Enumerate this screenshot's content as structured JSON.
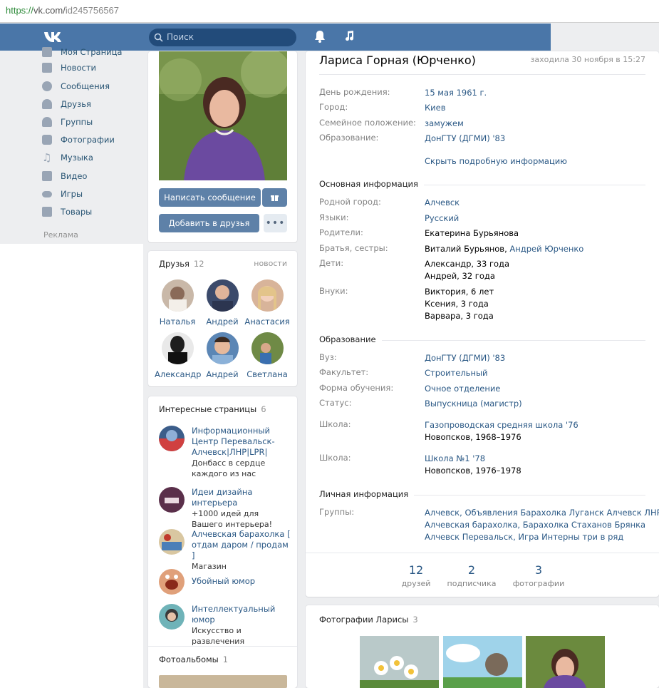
{
  "browser": {
    "proto": "https://",
    "host": "vk.com/",
    "path": "id245756567"
  },
  "header": {
    "search_placeholder": "Поиск"
  },
  "nav": {
    "items": [
      {
        "label": "Моя Страница",
        "icon": "home-icon"
      },
      {
        "label": "Новости",
        "icon": "news-icon"
      },
      {
        "label": "Сообщения",
        "icon": "messages-icon"
      },
      {
        "label": "Друзья",
        "icon": "friends-icon"
      },
      {
        "label": "Группы",
        "icon": "groups-icon"
      },
      {
        "label": "Фотографии",
        "icon": "camera-icon"
      },
      {
        "label": "Музыка",
        "icon": "music-icon"
      },
      {
        "label": "Видео",
        "icon": "video-icon"
      },
      {
        "label": "Игры",
        "icon": "gamepad-icon"
      },
      {
        "label": "Товары",
        "icon": "bag-icon"
      }
    ],
    "ads": "Реклама"
  },
  "profile_actions": {
    "message": "Написать сообщение",
    "add_friend": "Добавить в друзья"
  },
  "friends": {
    "title": "Друзья",
    "count": "12",
    "news": "новости",
    "list": [
      {
        "name": "Наталья",
        "color": "#c9b8a8"
      },
      {
        "name": "Андрей",
        "color": "#3b4a6b"
      },
      {
        "name": "Анастасия",
        "color": "#d8b49a"
      },
      {
        "name": "Александр",
        "color": "#2b2b2b"
      },
      {
        "name": "Андрей",
        "color": "#5b86b5"
      },
      {
        "name": "Светлана",
        "color": "#6f8a46"
      }
    ]
  },
  "pages": {
    "title": "Интересные страницы",
    "count": "6",
    "list": [
      {
        "name": "Информационный Центр Перевальск-Алчевск|ЛНР|LPR|",
        "desc": "Донбасс в сердце каждого из нас",
        "color": "#3b5d8a"
      },
      {
        "name": "Идеи дизайна интерьера",
        "desc": "+1000 идей для Вашего интерьера!",
        "color": "#5a2f4a"
      },
      {
        "name": "Алчевская барахолка [ отдам даром / продам ]",
        "desc": "Магазин",
        "color": "#d9c7a1"
      },
      {
        "name": "Убойный юмор",
        "desc": "",
        "color": "#e0a07a"
      },
      {
        "name": "Интеллектуальный юмор",
        "desc": "Искусство и развлечения",
        "color": "#6fb3b8"
      }
    ]
  },
  "albums": {
    "title": "Фотоальбомы",
    "count": "1"
  },
  "profile": {
    "name": "Лариса Горная (Юрченко)",
    "last_seen": "заходила 30 ноября в 15:27",
    "birthday_label": "День рождения:",
    "birthday": "15 мая 1961 г.",
    "city_label": "Город:",
    "city": "Киев",
    "family_label": "Семейное положение:",
    "family": "замужем",
    "edu_label": "Образование:",
    "edu": "ДонГТУ (ДГМИ) '83",
    "hide_info": "Скрыть подробную информацию",
    "main_info": "Основная информация",
    "hometown_label": "Родной город:",
    "hometown": "Алчевск",
    "langs_label": "Языки:",
    "langs": "Русский",
    "parents_label": "Родители:",
    "parents": "Екатерина Бурьянова",
    "siblings_label": "Братья, сестры:",
    "sibling1": "Виталий Бурьянов,",
    "sibling2": "Андрей Юрченко",
    "children_label": "Дети:",
    "child1": "Александр, 33 года",
    "child2": "Андрей, 32 года",
    "grand_label": "Внуки:",
    "grand1": "Виктория, 6 лет",
    "grand2": "Ксения, 3 года",
    "grand3": "Варвара, 3 года",
    "education": "Образование",
    "uni_label": "Вуз:",
    "uni": "ДонГТУ (ДГМИ) '83",
    "faculty_label": "Факультет:",
    "faculty": "Строительный",
    "form_label": "Форма обучения:",
    "form": "Очное отделение",
    "status_label": "Статус:",
    "status": "Выпускница (магистр)",
    "school_label": "Школа:",
    "school1": "Газопроводская средняя школа '76",
    "school1_place": "Новопсков, 1968–1976",
    "school2": "Школа №1 '78",
    "school2_place": "Новопсков, 1976–1978",
    "personal": "Личная информация",
    "groups_label": "Группы:",
    "groups_line1": "Алчевск, Объявления Барахолка Луганск Алчевск ЛНР,",
    "groups_line2": "Алчевская барахолка, Барахолка Стаханов Брянка",
    "groups_line3": "Алчевск Перевальск, Игра Интерны три в ряд"
  },
  "counters": [
    {
      "n": "12",
      "l": "друзей"
    },
    {
      "n": "2",
      "l": "подписчика"
    },
    {
      "n": "3",
      "l": "фотографии"
    }
  ],
  "photos": {
    "title": "Фотографии Ларисы",
    "count": "3"
  }
}
